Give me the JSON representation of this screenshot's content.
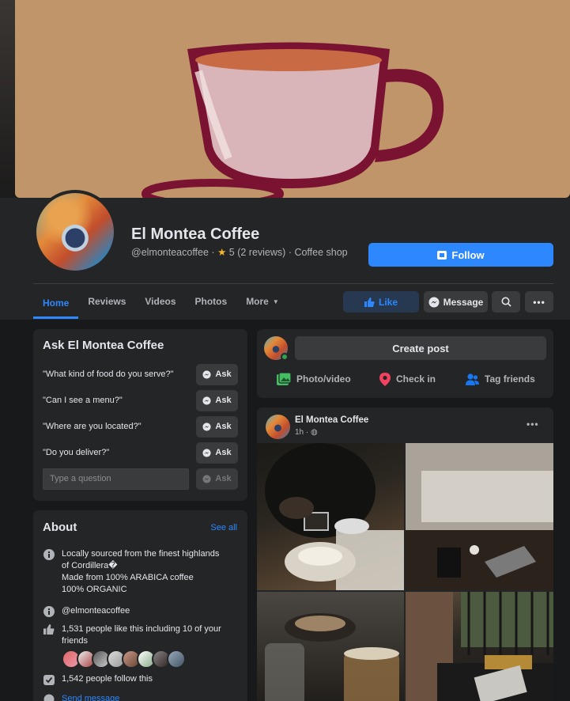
{
  "page": {
    "name": "El Montea Coffee",
    "handle": "@elmonteacoffee",
    "rating": "5",
    "reviews": "(2 reviews)",
    "category": "Coffee shop",
    "follow_label": "Follow"
  },
  "tabs": [
    {
      "label": "Home",
      "active": true
    },
    {
      "label": "Reviews"
    },
    {
      "label": "Videos"
    },
    {
      "label": "Photos"
    },
    {
      "label": "More"
    }
  ],
  "actions": {
    "like_label": "Like",
    "message_label": "Message"
  },
  "ask": {
    "title": "Ask El Montea Coffee",
    "questions": [
      "\"What kind of food do you serve?\"",
      "\"Can I see a menu?\"",
      "\"Where are you located?\"",
      "\"Do you deliver?\""
    ],
    "ask_label": "Ask",
    "input_placeholder": "Type a question"
  },
  "about": {
    "title": "About",
    "see_all": "See all",
    "description": [
      "Locally sourced from the finest highlands",
      "of Cordillera�",
      "Made from 100% ARABICA coffee",
      "100% ORGANIC"
    ],
    "handle": "@elmonteacoffee",
    "likes": "1,531 people like this including 10 of your friends",
    "follows": "1,542 people follow this",
    "send_message": "Send message"
  },
  "composer": {
    "create_post": "Create post",
    "photo_video": "Photo/video",
    "check_in": "Check in",
    "tag_friends": "Tag friends"
  },
  "post": {
    "author": "El Montea Coffee",
    "time": "1h"
  },
  "colors": {
    "accent": "#2d88ff",
    "background": "#18191a",
    "card": "#242526",
    "cover": "#c0956a",
    "cup": "#7a1231"
  }
}
